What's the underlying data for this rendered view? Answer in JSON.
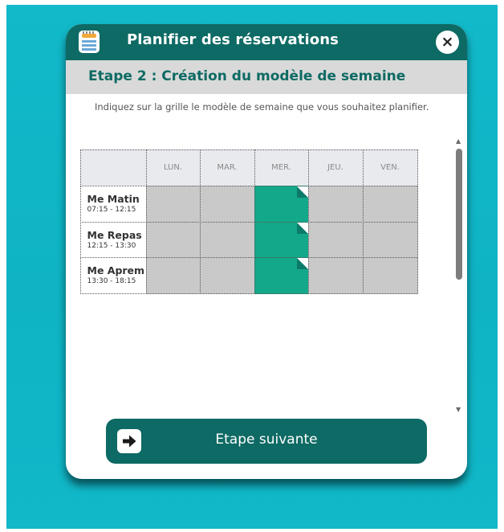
{
  "dialog": {
    "title": "Planifier des réservations",
    "close_label": "×",
    "app_icon": "calendar-icon"
  },
  "step": {
    "title": "Etape 2 : Création du modèle de semaine",
    "instructions": "Indiquez sur la grille le modèle de semaine que vous souhaitez planifier."
  },
  "grid": {
    "days": [
      "LUN.",
      "MAR.",
      "MER.",
      "JEU.",
      "VEN."
    ],
    "slots": [
      {
        "name": "Me Matin",
        "time": "07:15 - 12:15",
        "selected": [
          false,
          false,
          true,
          false,
          false
        ]
      },
      {
        "name": "Me Repas",
        "time": "12:15 - 13:30",
        "selected": [
          false,
          false,
          true,
          false,
          false
        ]
      },
      {
        "name": "Me Aprem",
        "time": "13:30 - 18:15",
        "selected": [
          false,
          false,
          true,
          false,
          false
        ]
      }
    ]
  },
  "footer": {
    "next_label": "Etape suivante",
    "next_icon": "arrow-right-icon"
  },
  "colors": {
    "header": "#0e6a64",
    "selected": "#14a88a",
    "unselected": "#c9c9c9",
    "background": "#11b9c9"
  }
}
